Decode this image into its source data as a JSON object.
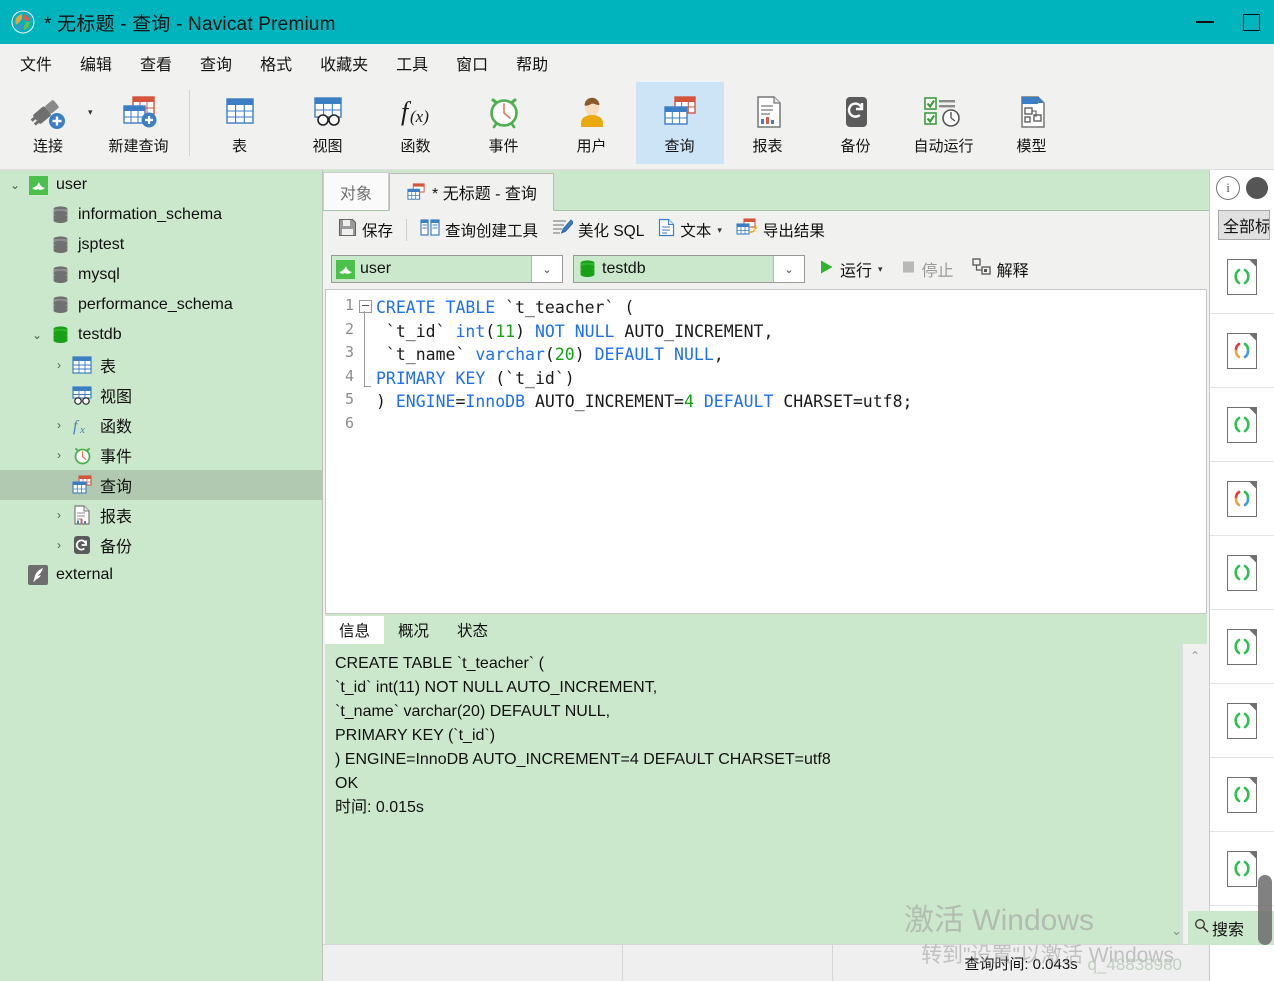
{
  "window": {
    "title": "* 无标题 - 查询 - Navicat Premium",
    "minimize": "—",
    "maximize": "□",
    "accent_teal": "#00b4bd"
  },
  "menubar": {
    "items": [
      "文件",
      "编辑",
      "查看",
      "查询",
      "格式",
      "收藏夹",
      "工具",
      "窗口",
      "帮助"
    ]
  },
  "toolbar": {
    "buttons": [
      {
        "label": "连接",
        "icon": "connection-plug-icon",
        "active": false,
        "caret": true
      },
      {
        "label": "新建查询",
        "icon": "new-query-icon",
        "active": false,
        "caret": false
      },
      {
        "label": "表",
        "icon": "table-icon",
        "active": false,
        "caret": false
      },
      {
        "label": "视图",
        "icon": "view-icon",
        "active": false,
        "caret": false
      },
      {
        "label": "函数",
        "icon": "function-fx-icon",
        "active": false,
        "caret": false
      },
      {
        "label": "事件",
        "icon": "event-clock-icon",
        "active": false,
        "caret": false
      },
      {
        "label": "用户",
        "icon": "user-icon",
        "active": false,
        "caret": false
      },
      {
        "label": "查询",
        "icon": "query-icon",
        "active": true,
        "caret": false
      },
      {
        "label": "报表",
        "icon": "report-icon",
        "active": false,
        "caret": false
      },
      {
        "label": "备份",
        "icon": "backup-icon",
        "active": false,
        "caret": false
      },
      {
        "label": "自动运行",
        "icon": "automation-icon",
        "active": false,
        "caret": false
      },
      {
        "label": "模型",
        "icon": "model-icon",
        "active": false,
        "caret": false
      }
    ]
  },
  "sidebar": {
    "tree": [
      {
        "label": "user",
        "icon": "mysql-dolphin-icon",
        "depth": 0,
        "twisty": "down",
        "selected": false
      },
      {
        "label": "information_schema",
        "icon": "database-gray-icon",
        "depth": 1,
        "twisty": "",
        "selected": false
      },
      {
        "label": "jsptest",
        "icon": "database-gray-icon",
        "depth": 1,
        "twisty": "",
        "selected": false
      },
      {
        "label": "mysql",
        "icon": "database-gray-icon",
        "depth": 1,
        "twisty": "",
        "selected": false
      },
      {
        "label": "performance_schema",
        "icon": "database-gray-icon",
        "depth": 1,
        "twisty": "",
        "selected": false
      },
      {
        "label": "testdb",
        "icon": "database-green-icon",
        "depth": 1,
        "twisty": "down",
        "selected": false
      },
      {
        "label": "表",
        "icon": "table-icon",
        "depth": 2,
        "twisty": "right",
        "selected": false
      },
      {
        "label": "视图",
        "icon": "view-icon",
        "depth": 2,
        "twisty": "",
        "selected": false
      },
      {
        "label": "函数",
        "icon": "function-fx-icon",
        "depth": 2,
        "twisty": "right",
        "selected": false
      },
      {
        "label": "事件",
        "icon": "event-clock-icon",
        "depth": 2,
        "twisty": "right",
        "selected": false
      },
      {
        "label": "查询",
        "icon": "query-icon",
        "depth": 2,
        "twisty": "",
        "selected": true
      },
      {
        "label": "报表",
        "icon": "report-icon",
        "depth": 2,
        "twisty": "right",
        "selected": false
      },
      {
        "label": "备份",
        "icon": "backup-icon",
        "depth": 2,
        "twisty": "right",
        "selected": false
      },
      {
        "label": "external",
        "icon": "sqlite-feather-icon",
        "depth": 0,
        "twisty": "",
        "selected": false
      }
    ]
  },
  "tabs": [
    {
      "label": "对象",
      "active": false,
      "icon": ""
    },
    {
      "label": "* 无标题 - 查询",
      "active": true,
      "icon": "query-icon"
    }
  ],
  "query_toolbar": {
    "buttons": [
      {
        "label": "保存",
        "icon": "save-icon",
        "caret": false
      },
      {
        "label": "查询创建工具",
        "icon": "query-builder-icon",
        "caret": false
      },
      {
        "label": "美化 SQL",
        "icon": "beautify-sql-icon",
        "caret": false
      },
      {
        "label": "文本",
        "icon": "text-icon",
        "caret": true
      },
      {
        "label": "导出结果",
        "icon": "export-result-icon",
        "caret": false
      }
    ]
  },
  "connection_bar": {
    "connection": "user",
    "database": "testdb",
    "run_label": "运行",
    "stop_label": "停止",
    "explain_label": "解释",
    "stop_disabled": true
  },
  "editor": {
    "line_numbers": [
      "1",
      "2",
      "3",
      "4",
      "5",
      "6"
    ],
    "lines": [
      [
        {
          "t": "CREATE TABLE",
          "c": "kw"
        },
        {
          "t": " `t_teacher` (",
          "c": "id"
        }
      ],
      [
        {
          "t": " `t_id` ",
          "c": "id"
        },
        {
          "t": "int",
          "c": "kw"
        },
        {
          "t": "(",
          "c": "id"
        },
        {
          "t": "11",
          "c": "num"
        },
        {
          "t": ") ",
          "c": "id"
        },
        {
          "t": "NOT NULL",
          "c": "kw"
        },
        {
          "t": " AUTO_INCREMENT,",
          "c": "id"
        }
      ],
      [
        {
          "t": " `t_name` ",
          "c": "id"
        },
        {
          "t": "varchar",
          "c": "kw"
        },
        {
          "t": "(",
          "c": "id"
        },
        {
          "t": "20",
          "c": "num"
        },
        {
          "t": ") ",
          "c": "id"
        },
        {
          "t": "DEFAULT NULL",
          "c": "kw"
        },
        {
          "t": ",",
          "c": "id"
        }
      ],
      [
        {
          "t": "PRIMARY KEY",
          "c": "kw"
        },
        {
          "t": " (`t_id`)",
          "c": "id"
        }
      ],
      [
        {
          "t": ") ",
          "c": "id"
        },
        {
          "t": "ENGINE",
          "c": "kw"
        },
        {
          "t": "=",
          "c": "id"
        },
        {
          "t": "InnoDB",
          "c": "kw"
        },
        {
          "t": " AUTO_INCREMENT=",
          "c": "id"
        },
        {
          "t": "4",
          "c": "num"
        },
        {
          "t": " DEFAULT",
          "c": "kw"
        },
        {
          "t": " CHARSET=utf8;",
          "c": "id"
        }
      ],
      []
    ]
  },
  "result": {
    "tabs": [
      {
        "label": "信息",
        "active": true
      },
      {
        "label": "概况",
        "active": false
      },
      {
        "label": "状态",
        "active": false
      }
    ],
    "message": "CREATE TABLE `t_teacher` (\n`t_id` int(11) NOT NULL AUTO_INCREMENT,\n`t_name` varchar(20) DEFAULT NULL,\nPRIMARY KEY (`t_id`)\n) ENGINE=InnoDB AUTO_INCREMENT=4 DEFAULT CHARSET=utf8\nOK\n时间: 0.015s"
  },
  "status_bar": {
    "query_time": "查询时间: 0.043s"
  },
  "right_panel": {
    "info_icon": "info-circle-icon",
    "second_icon": "dark-circle-icon",
    "select_all_label": "全部标",
    "snippets": [
      {
        "icon": "code-snippet-green-icon",
        "color": "#2fbf4e"
      },
      {
        "icon": "code-snippet-multicolor-icon",
        "color": "multi"
      },
      {
        "icon": "code-snippet-green-icon",
        "color": "#2fbf4e"
      },
      {
        "icon": "code-snippet-multicolor-icon",
        "color": "multi"
      },
      {
        "icon": "code-snippet-green-icon",
        "color": "#2fbf4e"
      },
      {
        "icon": "code-snippet-green-icon",
        "color": "#2fbf4e"
      },
      {
        "icon": "code-snippet-green-icon",
        "color": "#2fbf4e"
      },
      {
        "icon": "code-snippet-green-icon",
        "color": "#2fbf4e"
      },
      {
        "icon": "code-snippet-green-icon",
        "color": "#2fbf4e"
      }
    ],
    "search_placeholder": "搜索"
  },
  "watermarks": {
    "activate_line1": "激活 Windows",
    "activate_line2": "转到\"设置\"以激活 Windows",
    "blog": "q_48838980"
  }
}
